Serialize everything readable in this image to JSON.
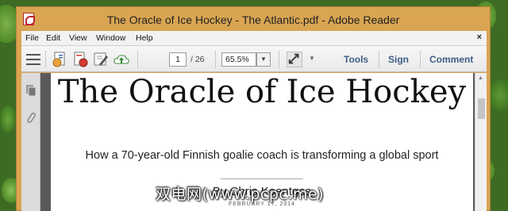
{
  "window": {
    "title": "The Oracle of Ice Hockey - The Atlantic.pdf - Adobe Reader"
  },
  "menu": {
    "items": [
      "File",
      "Edit",
      "View",
      "Window",
      "Help"
    ],
    "close": "×"
  },
  "toolbar": {
    "page_current": "1",
    "page_total": "/ 26",
    "zoom": "65.5%",
    "links": [
      "Tools",
      "Sign",
      "Comment"
    ]
  },
  "document": {
    "headline": "The Oracle of Ice Hockey",
    "subhead": "How a 70-year-old Finnish goalie coach is transforming a global sport",
    "byline": "By Chris Koentges",
    "date": "FEBRUARY 17, 2014"
  },
  "watermark": "双电网(www.pcpc.me)",
  "icons": {
    "app": "adobe-reader-icon",
    "menu": "hamburger-icon",
    "create": "create-pdf-icon",
    "export": "export-pdf-icon",
    "edit": "edit-icon",
    "upload": "cloud-upload-icon",
    "expand": "expand-icon",
    "pages": "pages-panel-icon",
    "attach": "paperclip-icon"
  }
}
